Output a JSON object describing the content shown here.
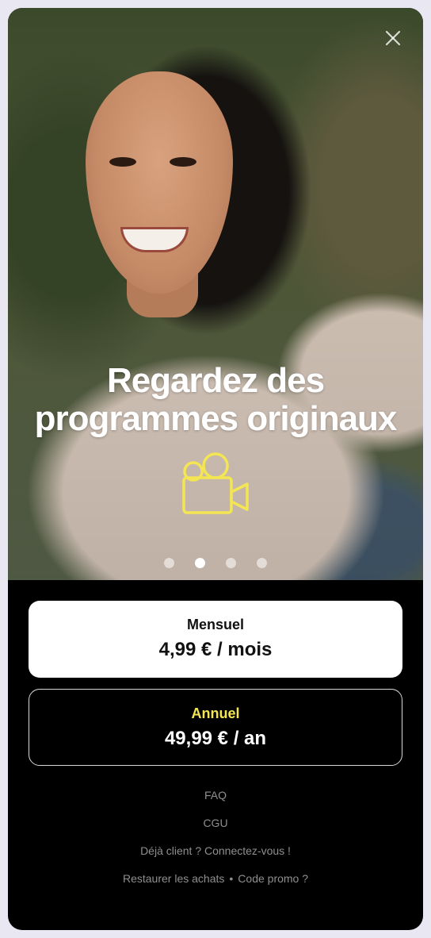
{
  "hero": {
    "title_line1": "Regardez des",
    "title_line2": "programmes originaux",
    "feature_icon": "video-camera-icon",
    "close_icon": "close-icon",
    "accent_color": "#f4e652",
    "carousel": {
      "count": 4,
      "active_index": 1
    }
  },
  "plans": [
    {
      "name": "Mensuel",
      "price": "4,99 € / mois",
      "selected": true
    },
    {
      "name": "Annuel",
      "price": "49,99 € / an",
      "selected": false
    }
  ],
  "links": {
    "faq": "FAQ",
    "cgu": "CGU",
    "login": "Déjà client ? Connectez-vous !",
    "restore": "Restaurer les achats",
    "separator": "•",
    "promo": "Code promo ?"
  }
}
